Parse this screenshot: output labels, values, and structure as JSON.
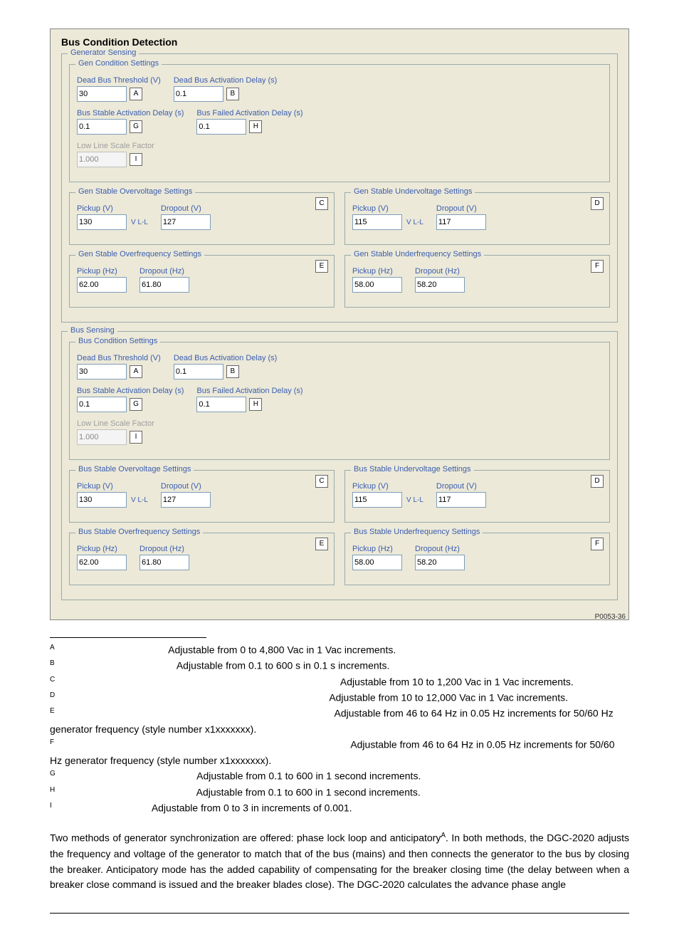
{
  "dlg": {
    "title": "Bus Condition Detection",
    "gen_sensing": {
      "legend": "Generator Sensing",
      "cond": {
        "legend": "Gen Condition Settings",
        "dead_thresh": {
          "label": "Dead Bus Threshold (V)",
          "value": "30",
          "tag": "A"
        },
        "dead_delay": {
          "label": "Dead Bus Activation Delay (s)",
          "value": "0.1",
          "tag": "B"
        },
        "stable_delay": {
          "label": "Bus Stable Activation Delay (s)",
          "value": "0.1",
          "tag": "G"
        },
        "failed_delay": {
          "label": "Bus Failed Activation Delay (s)",
          "value": "0.1",
          "tag": "H"
        },
        "low_line": {
          "label": "Low Line Scale Factor",
          "value": "1.000",
          "tag": "I"
        }
      },
      "ov": {
        "legend": "Gen Stable Overvoltage Settings",
        "pickup_l": "Pickup (V)",
        "pickup_v": "130",
        "dropout_l": "Dropout (V)",
        "dropout_v": "127",
        "tag": "C",
        "unit": "V L-L"
      },
      "uv": {
        "legend": "Gen Stable Undervoltage Settings",
        "pickup_l": "Pickup (V)",
        "pickup_v": "115",
        "dropout_l": "Dropout (V)",
        "dropout_v": "117",
        "tag": "D",
        "unit": "V L-L"
      },
      "of": {
        "legend": "Gen Stable Overfrequency Settings",
        "pickup_l": "Pickup (Hz)",
        "pickup_v": "62.00",
        "dropout_l": "Dropout (Hz)",
        "dropout_v": "61.80",
        "tag": "E"
      },
      "uf": {
        "legend": "Gen Stable Underfrequency Settings",
        "pickup_l": "Pickup (Hz)",
        "pickup_v": "58.00",
        "dropout_l": "Dropout (Hz)",
        "dropout_v": "58.20",
        "tag": "F"
      }
    },
    "bus_sensing": {
      "legend": "Bus Sensing",
      "cond": {
        "legend": "Bus Condition Settings",
        "dead_thresh": {
          "label": "Dead Bus Threshold (V)",
          "value": "30",
          "tag": "A"
        },
        "dead_delay": {
          "label": "Dead Bus Activation Delay (s)",
          "value": "0.1",
          "tag": "B"
        },
        "stable_delay": {
          "label": "Bus Stable Activation Delay (s)",
          "value": "0.1",
          "tag": "G"
        },
        "failed_delay": {
          "label": "Bus Failed Activation Delay (s)",
          "value": "0.1",
          "tag": "H"
        },
        "low_line": {
          "label": "Low Line Scale Factor",
          "value": "1.000",
          "tag": "I"
        }
      },
      "ov": {
        "legend": "Bus Stable Overvoltage Settings",
        "pickup_l": "Pickup (V)",
        "pickup_v": "130",
        "dropout_l": "Dropout (V)",
        "dropout_v": "127",
        "tag": "C",
        "unit": "V L-L"
      },
      "uv": {
        "legend": "Bus Stable Undervoltage Settings",
        "pickup_l": "Pickup (V)",
        "pickup_v": "115",
        "dropout_l": "Dropout (V)",
        "dropout_v": "117",
        "tag": "D",
        "unit": "V L-L"
      },
      "of": {
        "legend": "Bus Stable Overfrequency Settings",
        "pickup_l": "Pickup (Hz)",
        "pickup_v": "62.00",
        "dropout_l": "Dropout (Hz)",
        "dropout_v": "61.80",
        "tag": "E"
      },
      "uf": {
        "legend": "Bus Stable Underfrequency Settings",
        "pickup_l": "Pickup (Hz)",
        "pickup_v": "58.00",
        "dropout_l": "Dropout (Hz)",
        "dropout_v": "58.20",
        "tag": "F"
      }
    },
    "figcode": "P0053-36"
  },
  "notes": {
    "A": "Adjustable from 0 to 4,800 Vac in 1 Vac increments.",
    "B": "Adjustable from 0.1 to 600 s in 0.1 s increments.",
    "C": "Adjustable from 10 to 1,200 Vac in 1 Vac increments.",
    "D": "Adjustable from 10 to 12,000 Vac in 1 Vac increments.",
    "E": "Adjustable from 46 to 64 Hz in 0.05 Hz increments for 50/60 Hz generator frequency (style number x1xxxxxxx).",
    "F": "Adjustable from 46 to 64 Hz in 0.05 Hz increments for 50/60 Hz generator frequency (style number x1xxxxxxx).",
    "G": "Adjustable from 0.1 to 600 in 1 second increments.",
    "H": "Adjustable from 0.1 to 600 in 1 second increments.",
    "I": "Adjustable from 0 to 3 in increments of 0.001."
  },
  "paragraph": "Two methods of generator synchronization are offered: phase lock loop and anticipatory",
  "paragraph_sup": "A",
  "paragraph_rest": ". In both methods, the DGC-2020 adjusts the frequency and voltage of the generator to match that of the bus (mains) and then connects the generator to the bus by closing the breaker. Anticipatory mode has the added capability of compensating for the breaker closing time (the delay between when a breaker close command is issued and the breaker blades close). The DGC-2020 calculates the advance phase angle"
}
